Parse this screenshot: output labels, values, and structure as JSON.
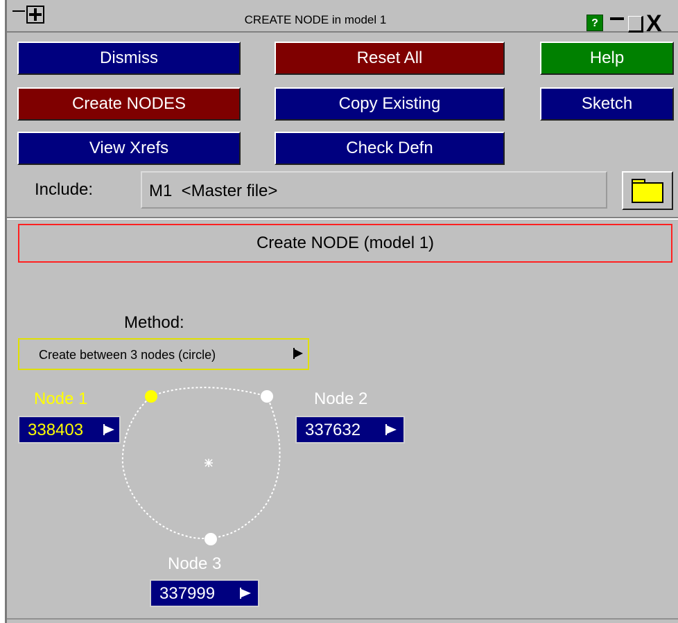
{
  "window": {
    "title": "CREATE NODE in model 1",
    "help_glyph": "?",
    "close_glyph": "X"
  },
  "buttons": {
    "dismiss": "Dismiss",
    "reset_all": "Reset All",
    "help": "Help",
    "create_nodes": "Create NODES",
    "copy_existing": "Copy Existing",
    "sketch": "Sketch",
    "view_xrefs": "View Xrefs",
    "check_defn": "Check Defn"
  },
  "include": {
    "label": "Include:",
    "value": "M1  <Master file>"
  },
  "panel": {
    "title": "Create NODE (model 1)"
  },
  "method": {
    "label": "Method:",
    "selected": "Create between 3 nodes (circle)"
  },
  "nodes": [
    {
      "label": "Node 1",
      "value": "338403",
      "color": "#ffff00"
    },
    {
      "label": "Node 2",
      "value": "337632",
      "color": "#ffffff"
    },
    {
      "label": "Node 3",
      "value": "337999",
      "color": "#ffffff"
    }
  ],
  "colors": {
    "panel_bg": "#c0c0c0",
    "button_blue": "#00007f",
    "button_red": "#7f0000",
    "button_green": "#008000",
    "active_node": "#ffff00",
    "frame_red": "#ff2020"
  }
}
